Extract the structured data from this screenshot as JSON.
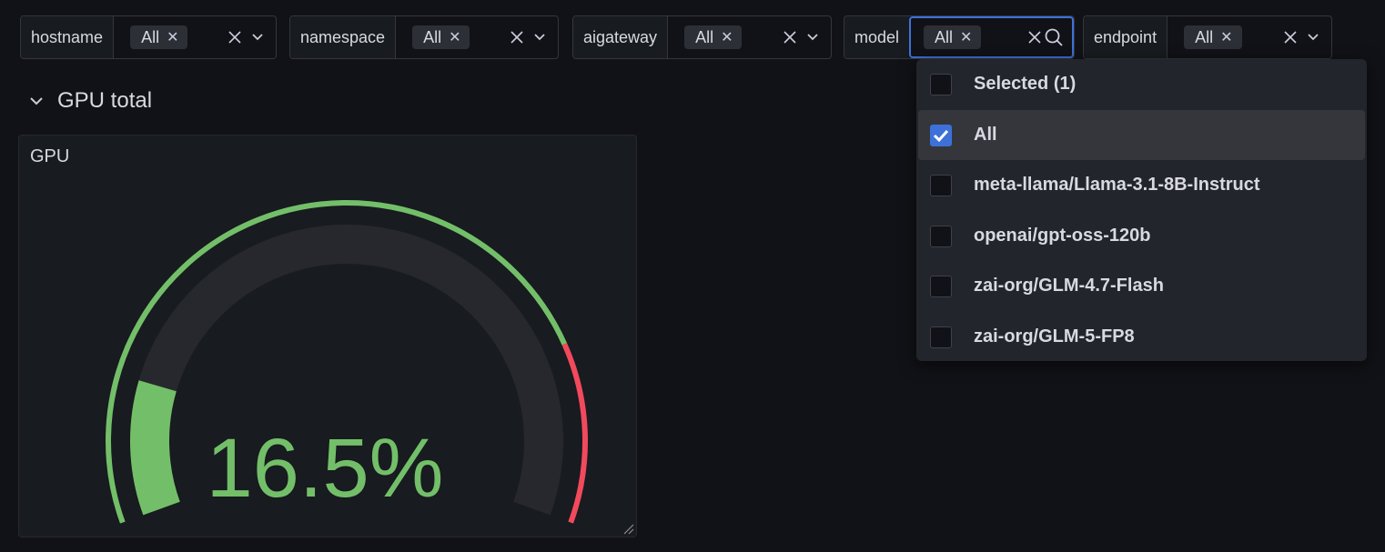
{
  "variables": [
    {
      "label": "hostname",
      "value": "All",
      "focused": false
    },
    {
      "label": "namespace",
      "value": "All",
      "focused": false
    },
    {
      "label": "aigateway",
      "value": "All",
      "focused": false
    },
    {
      "label": "model",
      "value": "All",
      "focused": true
    },
    {
      "label": "endpoint",
      "value": "All",
      "focused": false
    }
  ],
  "icons": {
    "remove_chip": "close-icon",
    "clear": "clear-icon",
    "open": "chevron-down-icon",
    "search": "search-icon",
    "collapse": "chevron-down-icon",
    "checkbox_checked": "checkmark-icon"
  },
  "section": {
    "title": "GPU total",
    "collapsed": false
  },
  "panel": {
    "title": "GPU",
    "value_text": "16.5%",
    "value": 16.5,
    "min": 0,
    "max": 100,
    "threshold_red": 80,
    "colors": {
      "green": "#73bf69",
      "red": "#f2495c",
      "track": "#26282d"
    }
  },
  "dropdown": {
    "header": "Selected (1)",
    "options": [
      {
        "label": "All",
        "checked": true,
        "active": true
      },
      {
        "label": "meta-llama/Llama-3.1-8B-Instruct",
        "checked": false,
        "active": false
      },
      {
        "label": "openai/gpt-oss-120b",
        "checked": false,
        "active": false
      },
      {
        "label": "zai-org/GLM-4.7-Flash",
        "checked": false,
        "active": false
      },
      {
        "label": "zai-org/GLM-5-FP8",
        "checked": false,
        "active": false
      }
    ]
  },
  "accent": "#3d71d9"
}
